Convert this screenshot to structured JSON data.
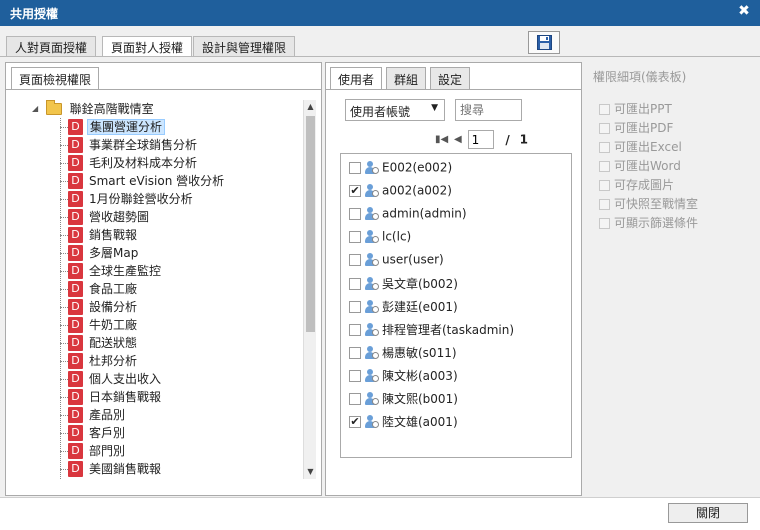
{
  "title": "共用授權",
  "close_glyph": "✖",
  "top_tabs": [
    "人對頁面授權",
    "頁面對人授權",
    "設計與管理權限"
  ],
  "left_tab": "頁面檢視權限",
  "tree": {
    "root": "聯銓高階戰情室",
    "icon_letter": "D",
    "items": [
      "集團營運分析",
      "事業群全球銷售分析",
      "毛利及材料成本分析",
      "Smart eVision 營收分析",
      "1月份聯銓營收分析",
      "營收趨勢圖",
      "銷售戰報",
      "多層Map",
      "全球生產監控",
      "食品工廠",
      "設備分析",
      "牛奶工廠",
      "配送狀態",
      "杜邦分析",
      "個人支出收入",
      "日本銷售戰報",
      "產品別",
      "客戶別",
      "部門別",
      "美國銷售戰報"
    ]
  },
  "mid_tabs": [
    "使用者",
    "群組",
    "設定"
  ],
  "select_value": "使用者帳號",
  "search_placeholder": "搜尋",
  "pager": {
    "page": "1",
    "sep": "/",
    "total": "1"
  },
  "users": [
    {
      "label": "E002(e002)",
      "checked": false
    },
    {
      "label": "a002(a002)",
      "checked": true
    },
    {
      "label": "admin(admin)",
      "checked": false
    },
    {
      "label": "lc(lc)",
      "checked": false
    },
    {
      "label": "user(user)",
      "checked": false
    },
    {
      "label": "吳文章(b002)",
      "checked": false
    },
    {
      "label": "彭建廷(e001)",
      "checked": false
    },
    {
      "label": "排程管理者(taskadmin)",
      "checked": false
    },
    {
      "label": "楊惠敏(s011)",
      "checked": false
    },
    {
      "label": "陳文彬(a003)",
      "checked": false
    },
    {
      "label": "陳文熙(b001)",
      "checked": false
    },
    {
      "label": "陸文雄(a001)",
      "checked": true
    }
  ],
  "right_title": "權限細項(儀表板)",
  "permissions": [
    "可匯出PPT",
    "可匯出PDF",
    "可匯出Excel",
    "可匯出Word",
    "可存成圖片",
    "可快照至戰情室",
    "可顯示篩選條件"
  ],
  "close_button": "關閉",
  "colors": {
    "titlebar": "#1f5f9c",
    "doc_icon": "#d9363e",
    "selected": "#cce6ff"
  }
}
